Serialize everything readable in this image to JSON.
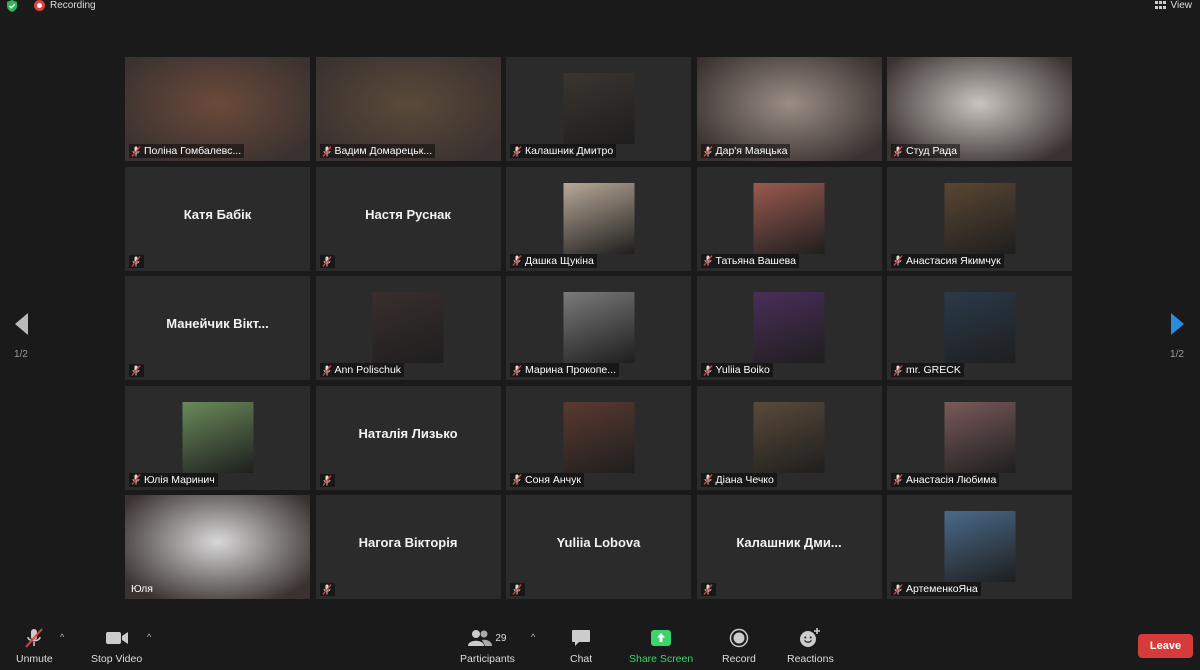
{
  "topbar": {
    "recording_label": "Recording",
    "view_label": "View"
  },
  "pagination": {
    "left": "1/2",
    "right": "1/2"
  },
  "tiles": [
    {
      "name": "Поліна Гомбалевс...",
      "type": "video",
      "bg": "#6b4a3a"
    },
    {
      "name": "Вадим Домарецьк...",
      "type": "video",
      "bg": "#5a4a38"
    },
    {
      "name": "Калашник Дмитро",
      "type": "pic",
      "bg": "#3a3530"
    },
    {
      "name": "Дар'я Маяцька",
      "type": "video",
      "bg": "#9a8e86"
    },
    {
      "name": "Студ Рада",
      "type": "video",
      "bg": "#c9c4c0"
    },
    {
      "name": "Катя Бабік",
      "type": "name"
    },
    {
      "name": "Настя Руснак",
      "type": "name"
    },
    {
      "name": "Дашка Щукіна",
      "type": "pic",
      "bg": "#b8a898"
    },
    {
      "name": "Татьяна Вашева",
      "type": "pic",
      "bg": "#9a5a50"
    },
    {
      "name": "Анастасия Якимчук",
      "type": "pic",
      "bg": "#5a4632"
    },
    {
      "name": "Манейчик  Вікт...",
      "type": "name"
    },
    {
      "name": "Ann Polischuk",
      "type": "pic",
      "bg": "#3a2e2e"
    },
    {
      "name": "Марина Прокопе...",
      "type": "pic",
      "bg": "#7a7a7a"
    },
    {
      "name": "Yuliia Boiko",
      "type": "pic",
      "bg": "#4a2e5a"
    },
    {
      "name": "mr. GRECK",
      "type": "pic",
      "bg": "#2a3a4a"
    },
    {
      "name": "Юлія Маринич",
      "type": "pic",
      "bg": "#6a8a5a"
    },
    {
      "name": "Наталія Лизько",
      "type": "name"
    },
    {
      "name": "Соня Анчук",
      "type": "pic",
      "bg": "#5a3a30"
    },
    {
      "name": "Діана Чечко",
      "type": "pic",
      "bg": "#5a4a3a"
    },
    {
      "name": "Анастасія Любима",
      "type": "pic",
      "bg": "#7a5a5a"
    },
    {
      "name": "Юля",
      "type": "active",
      "bg": "#d8d8d8"
    },
    {
      "name": "Нагога Вікторія",
      "type": "name"
    },
    {
      "name": "Yuliia Lobova",
      "type": "name"
    },
    {
      "name": "Калашник  Дми...",
      "type": "name"
    },
    {
      "name": "АртеменкоЯна",
      "type": "pic",
      "bg": "#4a6a8a"
    }
  ],
  "toolbar": {
    "unmute": "Unmute",
    "stop_video": "Stop Video",
    "participants": "Participants",
    "participants_count": "29",
    "chat": "Chat",
    "share_screen": "Share Screen",
    "record": "Record",
    "reactions": "Reactions",
    "leave": "Leave"
  },
  "colors": {
    "active_border": "#c9dd5a",
    "share_green": "#3dd36b",
    "leave_red": "#d63b3b",
    "arrow_blue": "#2a8cdc"
  }
}
